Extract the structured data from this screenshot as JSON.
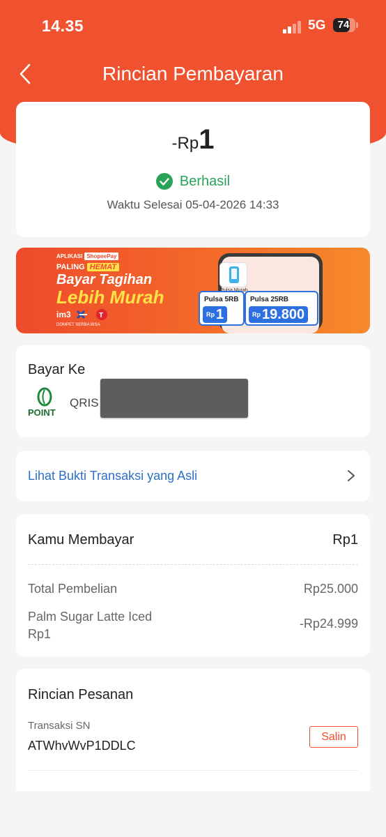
{
  "status_bar": {
    "time": "14.35",
    "network": "5G",
    "battery": "74",
    "battery_level_pct": 74
  },
  "header": {
    "title": "Rincian Pembayaran"
  },
  "summary": {
    "currency": "-Rp",
    "amount": "1",
    "status": "Berhasil",
    "finish_time": "Waktu Selesai 05-04-2026 14:33"
  },
  "banner": {
    "app_tag": "APLIKASI",
    "app_name": "ShopeePay",
    "paling": "PALING",
    "hemat": "HEMAT",
    "line1": "Bayar Tagihan",
    "line2": "Lebih Murah",
    "footer": "DOMPET SERBA BISA",
    "pulsa_icon_label": "Pulsa Murah",
    "offers": [
      {
        "title": "Pulsa 5RB",
        "currency": "Rp",
        "price": "1"
      },
      {
        "title": "Pulsa 25RB",
        "currency": "Rp",
        "price": "19.800"
      }
    ]
  },
  "payee": {
    "title": "Bayar Ke",
    "logo_text": "POINT",
    "method": "QRIS"
  },
  "proof": {
    "link": "Lihat Bukti Transaksi yang Asli"
  },
  "payment": {
    "title": "Kamu Membayar",
    "total": "Rp1",
    "rows": [
      {
        "label": "Total Pembelian",
        "value": "Rp25.000"
      },
      {
        "label": "Palm Sugar Latte Iced\nRp1",
        "value": "-Rp24.999"
      }
    ]
  },
  "order": {
    "title": "Rincian Pesanan",
    "sn_label": "Transaksi SN",
    "sn_value": "ATWhvWvP1DDLC",
    "copy_label": "Salin"
  },
  "colors": {
    "brand": "#f0512e",
    "success": "#2aa25a",
    "link": "#2c6fc9"
  }
}
